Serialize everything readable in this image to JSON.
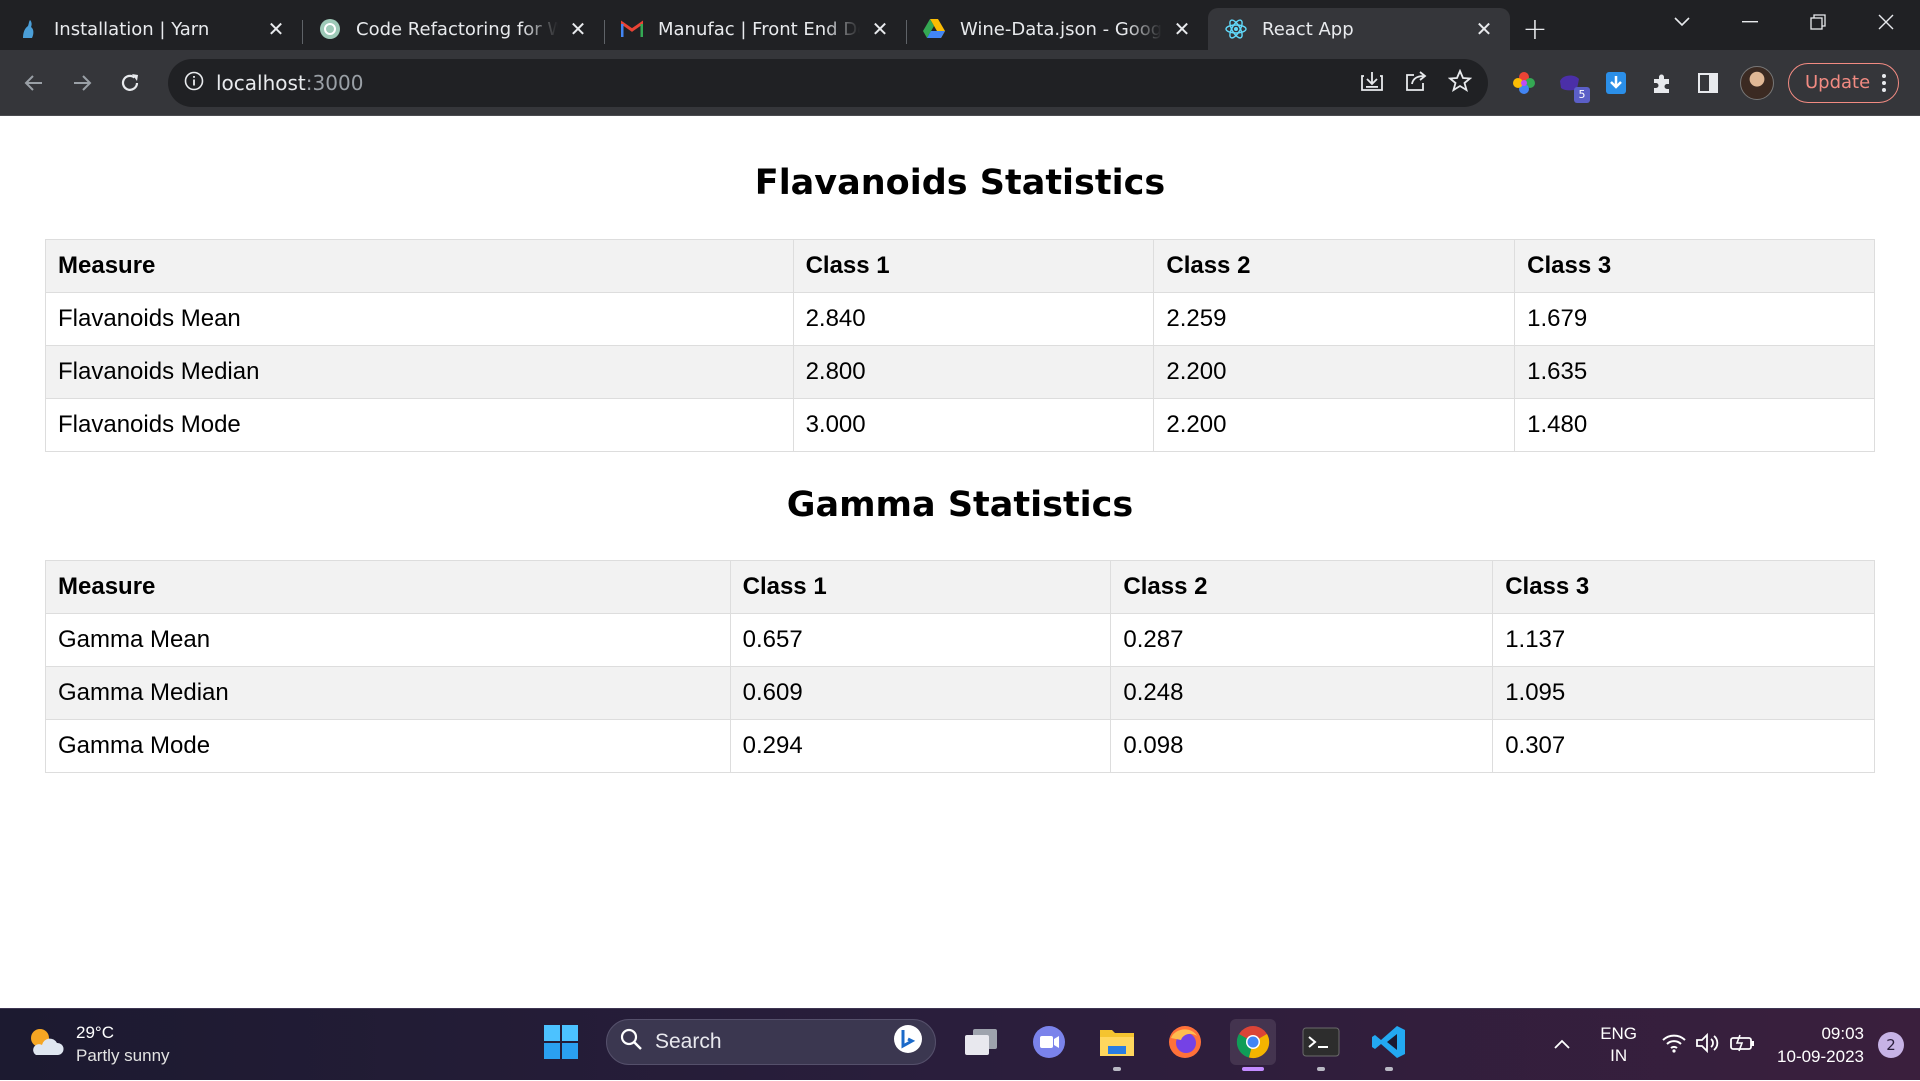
{
  "browser": {
    "tabs": [
      {
        "title": "Installation | Yarn",
        "icon": "yarn-icon"
      },
      {
        "title": "Code Refactoring for Wine",
        "icon": "chatgpt-icon"
      },
      {
        "title": "Manufac | Front End Developer",
        "icon": "gmail-icon"
      },
      {
        "title": "Wine-Data.json - Google Drive",
        "icon": "google-drive-icon"
      },
      {
        "title": "React App",
        "icon": "react-icon",
        "active": true
      }
    ],
    "url_host": "localhost",
    "url_port": ":3000",
    "update_label": "Update",
    "extension_badge": "5"
  },
  "page": {
    "flavanoids": {
      "title": "Flavanoids Statistics",
      "headers": [
        "Measure",
        "Class 1",
        "Class 2",
        "Class 3"
      ],
      "rows": [
        [
          "Flavanoids Mean",
          "2.840",
          "2.259",
          "1.679"
        ],
        [
          "Flavanoids Median",
          "2.800",
          "2.200",
          "1.635"
        ],
        [
          "Flavanoids Mode",
          "3.000",
          "2.200",
          "1.480"
        ]
      ]
    },
    "gamma": {
      "title": "Gamma Statistics",
      "headers": [
        "Measure",
        "Class 1",
        "Class 2",
        "Class 3"
      ],
      "rows": [
        [
          "Gamma Mean",
          "0.657",
          "0.287",
          "1.137"
        ],
        [
          "Gamma Median",
          "0.609",
          "0.248",
          "1.095"
        ],
        [
          "Gamma Mode",
          "0.294",
          "0.098",
          "0.307"
        ]
      ]
    }
  },
  "taskbar": {
    "weather_temp": "29°C",
    "weather_desc": "Partly sunny",
    "search_label": "Search",
    "lang_top": "ENG",
    "lang_bottom": "IN",
    "time": "09:03",
    "date": "10-09-2023",
    "notifications": "2"
  }
}
